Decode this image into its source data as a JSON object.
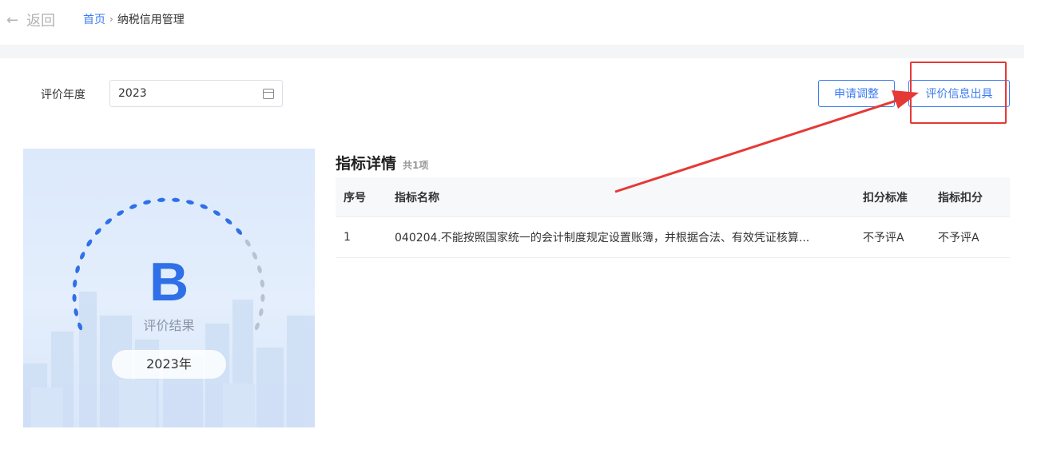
{
  "nav": {
    "back_label": "返回",
    "breadcrumb": {
      "home": "首页",
      "separator": "›",
      "current": "纳税信用管理"
    }
  },
  "filter": {
    "year_label": "评价年度",
    "year_value": "2023"
  },
  "actions": {
    "adjust_label": "申请调整",
    "issue_label": "评价信息出具"
  },
  "result_card": {
    "grade": "B",
    "grade_label": "评价结果",
    "year_pill": "2023年"
  },
  "detail": {
    "title": "指标详情",
    "count": "共1项",
    "columns": [
      "序号",
      "指标名称",
      "扣分标准",
      "指标扣分"
    ],
    "rows": [
      {
        "no": "1",
        "name": "040204.不能按照国家统一的会计制度规定设置账簿，并根据合法、有效凭证核算...",
        "standard": "不予评A",
        "deduction": "不予评A"
      }
    ]
  },
  "colors": {
    "primary": "#3b7cf0",
    "annotation_red": "#e53935",
    "card_bg": "#dbe9fb",
    "grade_blue": "#2f6fe8"
  }
}
